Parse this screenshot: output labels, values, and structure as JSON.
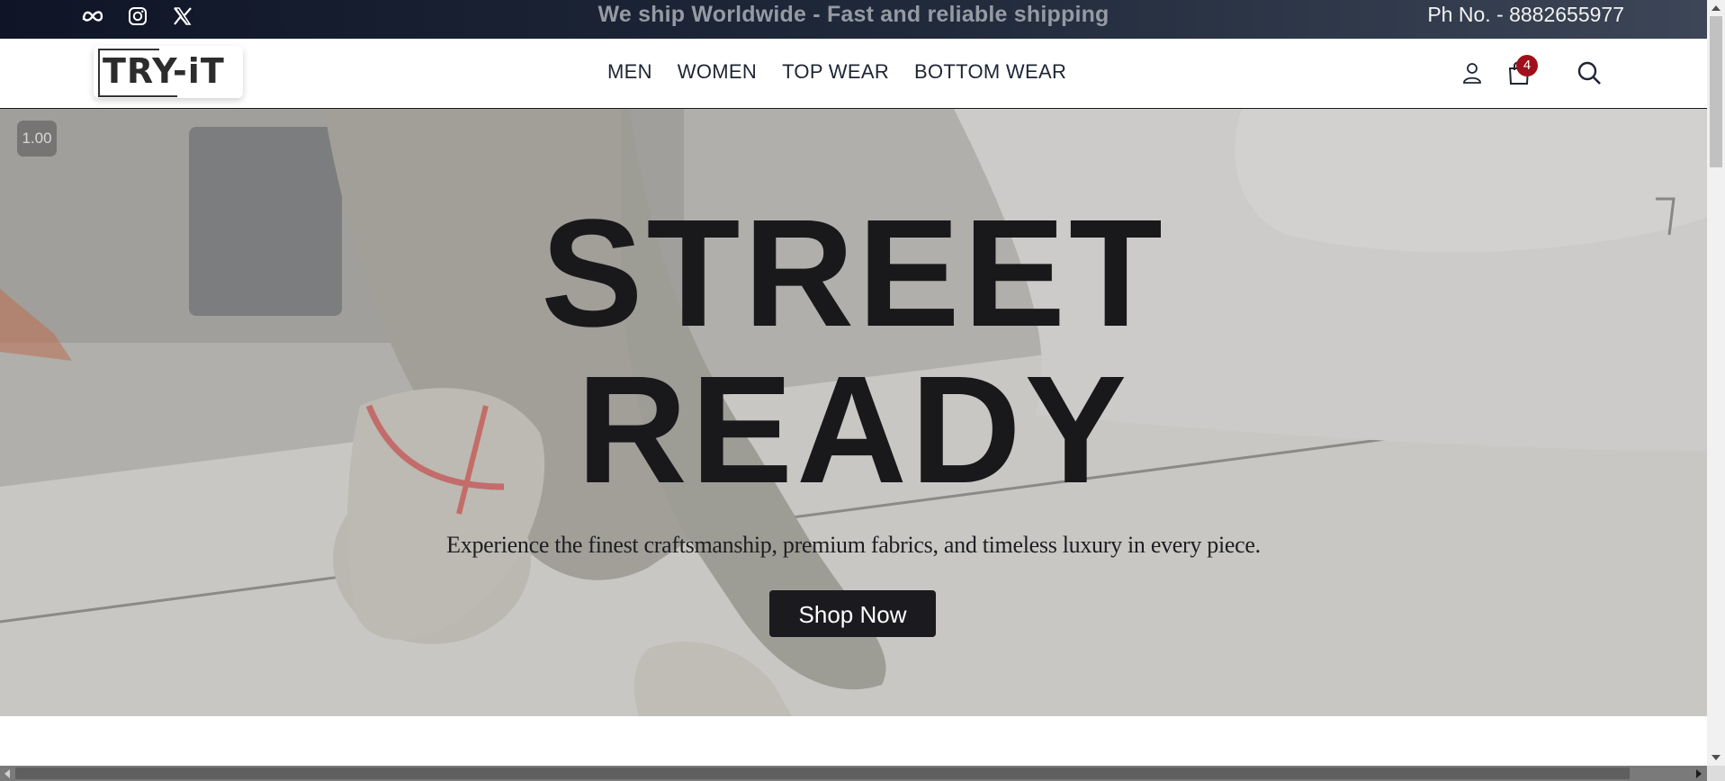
{
  "topbar": {
    "socials": [
      "meta-icon",
      "instagram-icon",
      "x-icon"
    ],
    "announcement": "We ship Worldwide - Fast and reliable shipping",
    "phone": "Ph No. - 8882655977"
  },
  "header": {
    "logo": "TRY-iT",
    "nav": [
      "MEN",
      "WOMEN",
      "TOP WEAR",
      "BOTTOM WEAR"
    ],
    "icons": [
      "user-icon",
      "shopping-bag-icon",
      "search-icon"
    ],
    "cart_count": "4"
  },
  "hero": {
    "playback_speed": "1.00",
    "title_line1": "STREET",
    "title_line2": "READY",
    "subtitle": "Experience the finest craftsmanship, premium fabrics, and timeless luxury in every piece.",
    "cta": "Shop Now"
  },
  "colors": {
    "topbar": "#1a2233",
    "badge": "#a0101a",
    "button": "#1b1b1f"
  }
}
